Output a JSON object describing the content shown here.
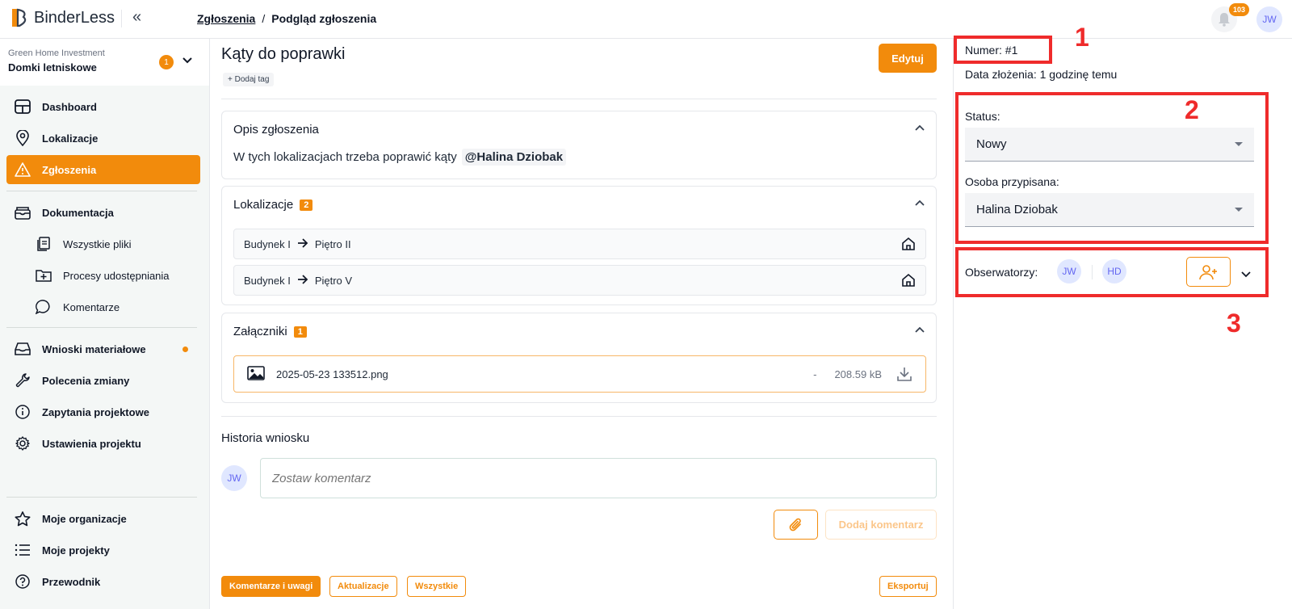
{
  "app": {
    "name": "BinderLess"
  },
  "header": {
    "breadcrumb_link": "Zgłoszenia",
    "breadcrumb_sep": "/",
    "breadcrumb_current": "Podgląd zgłoszenia",
    "notifications_count": "103",
    "user_initials": "JW"
  },
  "sidebar": {
    "org_name": "Green Home Investment",
    "project_name": "Domki letniskowe",
    "project_badge": "1",
    "items": [
      {
        "label": "Dashboard",
        "icon": "dashboard-icon"
      },
      {
        "label": "Lokalizacje",
        "icon": "location-pin-icon"
      },
      {
        "label": "Zgłoszenia",
        "icon": "warning-icon",
        "active": true
      },
      {
        "label": "Dokumentacja",
        "icon": "archive-icon"
      },
      {
        "label": "Wszystkie pliki",
        "icon": "file-icon"
      },
      {
        "label": "Procesy udostępniania",
        "icon": "folder-plus-icon"
      },
      {
        "label": "Komentarze",
        "icon": "comment-icon"
      },
      {
        "label": "Wnioski materiałowe",
        "icon": "inbox-icon"
      },
      {
        "label": "Polecenia zmiany",
        "icon": "wrench-icon"
      },
      {
        "label": "Zapytania projektowe",
        "icon": "info-icon"
      },
      {
        "label": "Ustawienia projektu",
        "icon": "gear-icon"
      }
    ],
    "bottom_items": [
      {
        "label": "Moje organizacje",
        "icon": "star-icon"
      },
      {
        "label": "Moje projekty",
        "icon": "list-icon"
      },
      {
        "label": "Przewodnik",
        "icon": "help-icon"
      }
    ]
  },
  "main": {
    "title": "Kąty do poprawki",
    "add_tag": "+ Dodaj tag",
    "edit_label": "Edytuj",
    "description": {
      "heading": "Opis zgłoszenia",
      "text": "W tych lokalizacjach trzeba poprawić kąty",
      "mention": "@Halina Dziobak"
    },
    "locations": {
      "heading": "Lokalizacje",
      "count": "2",
      "items": [
        {
          "building": "Budynek I",
          "floor": "Piętro II"
        },
        {
          "building": "Budynek I",
          "floor": "Piętro V"
        }
      ]
    },
    "attachments": {
      "heading": "Załączniki",
      "count": "1",
      "file_name": "2025-05-23 133512.png",
      "file_dash": "-",
      "file_size": "208.59 kB"
    },
    "history": {
      "heading": "Historia wniosku",
      "commenter_initials": "JW",
      "comment_placeholder": "Zostaw komentarz",
      "add_comment_label": "Dodaj komentarz"
    },
    "filters": {
      "comments": "Komentarze i uwagi",
      "updates": "Aktualizacje",
      "all": "Wszystkie",
      "export": "Eksportuj"
    }
  },
  "right_panel": {
    "number_label": "Numer:",
    "number_value": "#1",
    "date_label": "Data złożenia:",
    "date_value": "1 godzinę temu",
    "status_label": "Status:",
    "status_value": "Nowy",
    "assignee_label": "Osoba przypisana:",
    "assignee_value": "Halina Dziobak",
    "observers_label": "Obserwatorzy:",
    "observers": [
      "JW",
      "HD"
    ],
    "annotations": [
      "1",
      "2",
      "3"
    ]
  },
  "colors": {
    "accent": "#f28b0c",
    "annotation": "#ef2b2b"
  }
}
